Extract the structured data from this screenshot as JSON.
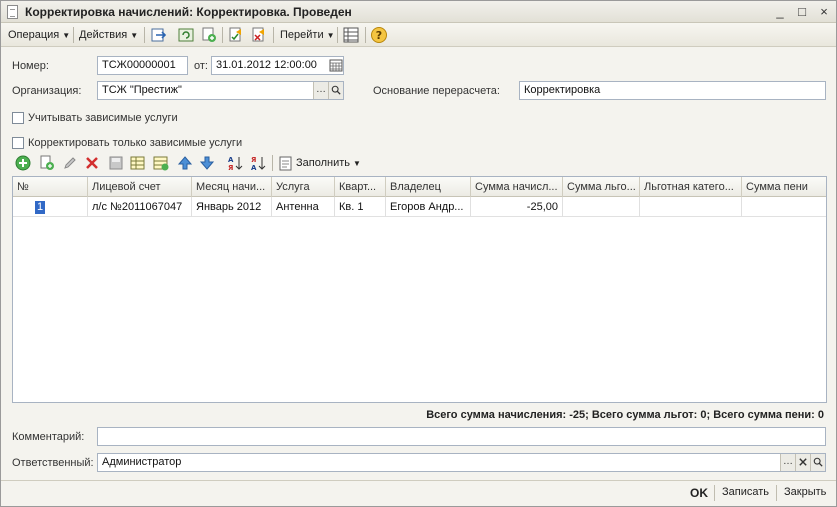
{
  "window": {
    "title": "Корректировка начислений: Корректировка. Проведен",
    "controls": [
      "_",
      "□",
      "×"
    ]
  },
  "toolbar": {
    "operation": "Операция",
    "actions": "Действия",
    "goto": "Перейти",
    "help": "?"
  },
  "form": {
    "number_label": "Номер:",
    "number_value": "ТСЖ00000001",
    "date_label": "от:",
    "date_value": "31.01.2012 12:00:00",
    "org_label": "Организация:",
    "org_value": "ТСЖ \"Престиж\"",
    "basis_label": "Основание перерасчета:",
    "basis_value": "Корректировка",
    "chk_dependent": "Учитывать зависимые услуги",
    "chk_only_dependent": "Корректировать только зависимые услуги",
    "fill_button": "Заполнить",
    "comment_label": "Комментарий:",
    "comment_value": "",
    "responsible_label": "Ответственный:",
    "responsible_value": "Администратор"
  },
  "table": {
    "headers": [
      "№",
      "Лицевой счет",
      "Месяц начи...",
      "Услуга",
      "Кварт...",
      "Владелец",
      "Сумма начисл...",
      "Сумма льго...",
      "Льготная катего...",
      "Сумма пени"
    ],
    "rows": [
      {
        "n": "1",
        "account": "л/с №2011067047",
        "month": "Январь 2012",
        "service": "Антенна",
        "apt": "Кв. 1",
        "owner": "Егоров Андр...",
        "sum": "-25,00",
        "benefit_sum": "",
        "benefit_cat": "",
        "penalty": ""
      }
    ]
  },
  "totals": "Всего сумма начисления: -25; Всего сумма льгот: 0; Всего сумма пени: 0",
  "footer": {
    "ok": "OK",
    "save": "Записать",
    "close": "Закрыть"
  },
  "colors": {
    "selection": "#3169c6",
    "field_border": "#a8b3c2"
  }
}
